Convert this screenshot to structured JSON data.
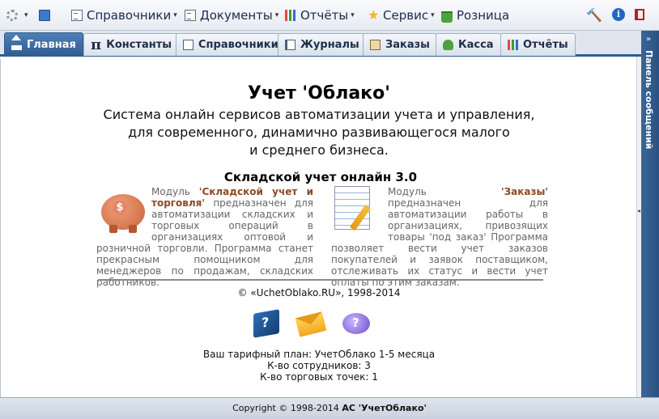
{
  "menu": {
    "items": [
      {
        "label": "Справочники",
        "icon": "document-icon"
      },
      {
        "label": "Документы",
        "icon": "document-icon"
      },
      {
        "label": "Отчёты",
        "icon": "chart-icon"
      },
      {
        "label": "Сервис",
        "icon": "star-icon"
      },
      {
        "label": "Розница",
        "icon": "basket-icon"
      }
    ],
    "dropdown_arrow": "▾",
    "tools": {
      "hammer": "🔨",
      "info": "i"
    }
  },
  "tabs": [
    {
      "label": "Главная",
      "icon": "home-icon",
      "active": true
    },
    {
      "label": "Константы",
      "icon": "pi-icon",
      "glyph": "π"
    },
    {
      "label": "Справочники",
      "icon": "document-icon"
    },
    {
      "label": "Журналы",
      "icon": "book-icon"
    },
    {
      "label": "Заказы",
      "icon": "box-icon"
    },
    {
      "label": "Касса",
      "icon": "money-icon"
    },
    {
      "label": "Отчёты",
      "icon": "chart-icon"
    }
  ],
  "side_panel": {
    "label": "Панель сообщений",
    "collapse": "»",
    "splitter": "◂"
  },
  "main": {
    "title": "Учет 'Облако'",
    "subtitle_lines": [
      "Система онлайн сервисов автоматизации учета и управления,",
      "для современного, динамично развивающегося малого",
      "и среднего бизнеса."
    ],
    "module_heading": "Складской учет онлайн 3.0",
    "left_module": {
      "pre": "Модуль ",
      "name": "'Складской учет и торговля'",
      "text": " предназначен для автоматизации складских и торговых операций в организациях оптовой и розничной торговли. Программа станет прекрасным помощником для менеджеров по продажам, складских работников.",
      "coin": "$"
    },
    "right_module": {
      "pre": "Модуль ",
      "name": "'Заказы'",
      "text": " предназначен для автоматизации работы в организациях, привозящих товары 'под заказ' Программа позволяет вести учет заказов покупателей и заявок поставщиком, отслеживать их статус и вести учет оплаты по этим заказам."
    },
    "copyright": "© «UchetOblako.RU», 1998-2014",
    "plan_line": "Ваш тарифный план: УчетОблако 1-5 месяца",
    "employees_line": "К-во сотрудников: 3",
    "points_line": "К-во торговых точек: 1"
  },
  "footer": {
    "prefix": "Copyright © 1998-2014 ",
    "brand": "АС 'УчетОблако'"
  }
}
